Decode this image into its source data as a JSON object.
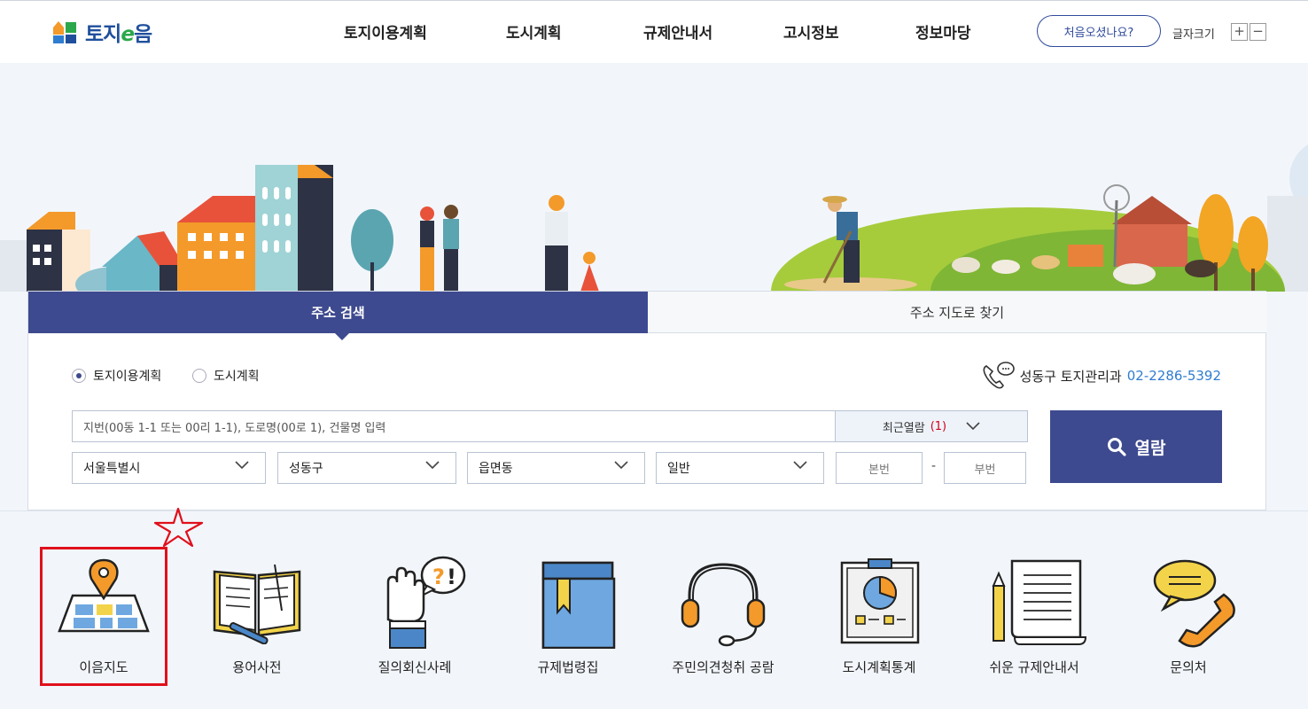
{
  "header": {
    "logo_text_1": "토지",
    "logo_text_e": "e",
    "logo_text_2": "음",
    "nav": [
      "토지이용계획",
      "도시계획",
      "규제안내서",
      "고시정보",
      "정보마당"
    ],
    "first_visit": "처음오셨나요?",
    "font_size_label": "글자크기",
    "font_plus": "+",
    "font_minus": "−"
  },
  "search": {
    "tabs": [
      "주소 검색",
      "주소 지도로 찾기"
    ],
    "radio_options": [
      "토지이용계획",
      "도시계획"
    ],
    "radio_selected": "토지이용계획",
    "contact_office": "성동구 토지관리과",
    "contact_phone": "02-2286-5392",
    "address_placeholder": "지번(00동 1-1 또는 00리 1-1), 도로명(00로 1), 건물명 입력",
    "recent_label": "최근열람",
    "recent_count": "(1)",
    "sido": "서울특별시",
    "sigungu": "성동구",
    "eupmyeondong": "읍면동",
    "land_type": "일반",
    "main_num_placeholder": "본번",
    "sub_num_placeholder": "부번",
    "dash": "-",
    "view_button": "열람"
  },
  "quick_menu": [
    {
      "label": "이음지도",
      "icon": "map-pin-icon"
    },
    {
      "label": "용어사전",
      "icon": "open-book-icon"
    },
    {
      "label": "질의회신사례",
      "icon": "hand-question-icon"
    },
    {
      "label": "규제법령집",
      "icon": "law-book-icon"
    },
    {
      "label": "주민의견청취 공람",
      "icon": "headset-icon"
    },
    {
      "label": "도시계획통계",
      "icon": "chart-board-icon"
    },
    {
      "label": "쉬운 규제안내서",
      "icon": "document-pencil-icon"
    },
    {
      "label": "문의처",
      "icon": "phone-chat-icon"
    }
  ],
  "colors": {
    "primary": "#3e4a8f",
    "highlight": "#e0101b",
    "link": "#2f7dd0"
  }
}
